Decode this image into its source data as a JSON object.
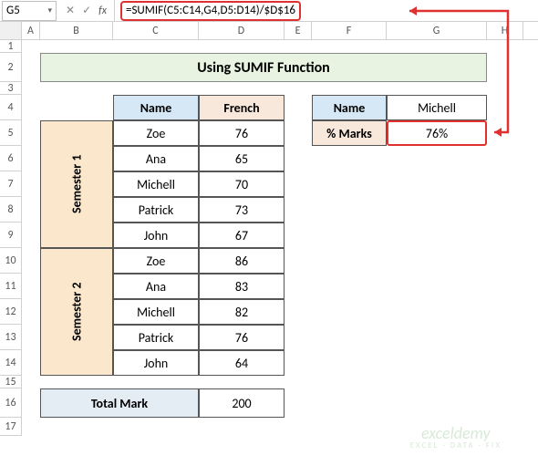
{
  "nameBox": "G5",
  "formula": "=SUMIF(C5:C14,G4,D5:D14)/$D$16",
  "columns": [
    "A",
    "B",
    "C",
    "D",
    "E",
    "F",
    "G",
    "H"
  ],
  "rows": [
    "1",
    "2",
    "3",
    "4",
    "5",
    "6",
    "7",
    "8",
    "9",
    "10",
    "11",
    "12",
    "13",
    "14",
    "15",
    "16",
    "17"
  ],
  "title": "Using SUMIF Function",
  "headers": {
    "name": "Name",
    "french": "French",
    "name2": "Name",
    "marks": "% Marks"
  },
  "sem1": "Semester 1",
  "sem2": "Semester 2",
  "data": [
    {
      "name": "Zoe",
      "french": "76"
    },
    {
      "name": "Ana",
      "french": "65"
    },
    {
      "name": "Michell",
      "french": "70"
    },
    {
      "name": "Patrick",
      "french": "73"
    },
    {
      "name": "John",
      "french": "67"
    },
    {
      "name": "Zoe",
      "french": "86"
    },
    {
      "name": "Ana",
      "french": "83"
    },
    {
      "name": "Michell",
      "french": "82"
    },
    {
      "name": "Patrick",
      "french": "76"
    },
    {
      "name": "John",
      "french": "64"
    }
  ],
  "totalLabel": "Total Mark",
  "totalValue": "200",
  "lookup": {
    "name": "Michell",
    "marks": "76%"
  },
  "watermark": {
    "main": "exceldemy",
    "sub": "EXCEL · DATA · FIX"
  }
}
